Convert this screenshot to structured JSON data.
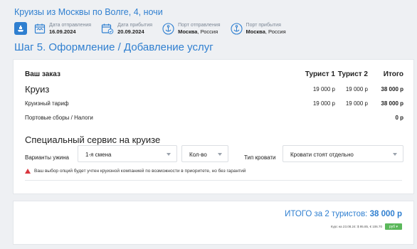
{
  "header": {
    "cruise_title": "Круизы из Москвы по Волге, 4, ночи",
    "departure_label": "Дата отправления",
    "departure_value": "16.09.2024",
    "arrival_label": "Дата прибытия",
    "arrival_value": "20.09.2024",
    "port_from_label": "Порт отправления",
    "port_from_city": "Москва",
    "port_from_country": ", Россия",
    "port_to_label": "Порт прибытия",
    "port_to_city": "Москва",
    "port_to_country": ", Россия",
    "step_title": "Шаг 5.  Оформление / Добавление услуг"
  },
  "order": {
    "heading": "Ваш заказ",
    "col_tourist1": "Турист 1",
    "col_tourist2": "Турист 2",
    "col_total": "Итого",
    "rows": [
      {
        "label": "Круиз",
        "t1": "19 000 р",
        "t2": "19 000 р",
        "total": "38 000 р"
      },
      {
        "label": "Круизный тариф",
        "t1": "19 000 р",
        "t2": "19 000 р",
        "total": "38 000 р"
      },
      {
        "label": "Портовые сборы / Налоги",
        "t1": "",
        "t2": "",
        "total": "0 р"
      }
    ]
  },
  "service": {
    "title": "Специальный сервис на круизе",
    "dinner_label": "Варианты ужина",
    "dinner_value": "1-я смена",
    "qty_value": "Кол-во",
    "bed_label": "Тип кровати",
    "bed_value": "Кровати стоят отдельно",
    "warning": "Ваш выбор опций будет учтен круизной компанией по возможности в приоритете, но без гарантий"
  },
  "summary": {
    "total_label": "ИТОГО за 2 туристов:",
    "total_value": "38 000 р",
    "rate_text": "Курс на 23.08.24: $ 95.85, € 106.70",
    "currency": "руб"
  },
  "colors": {
    "accent": "#2f7fd0",
    "warning": "#d9363e",
    "currency_button": "#5cb85c"
  }
}
